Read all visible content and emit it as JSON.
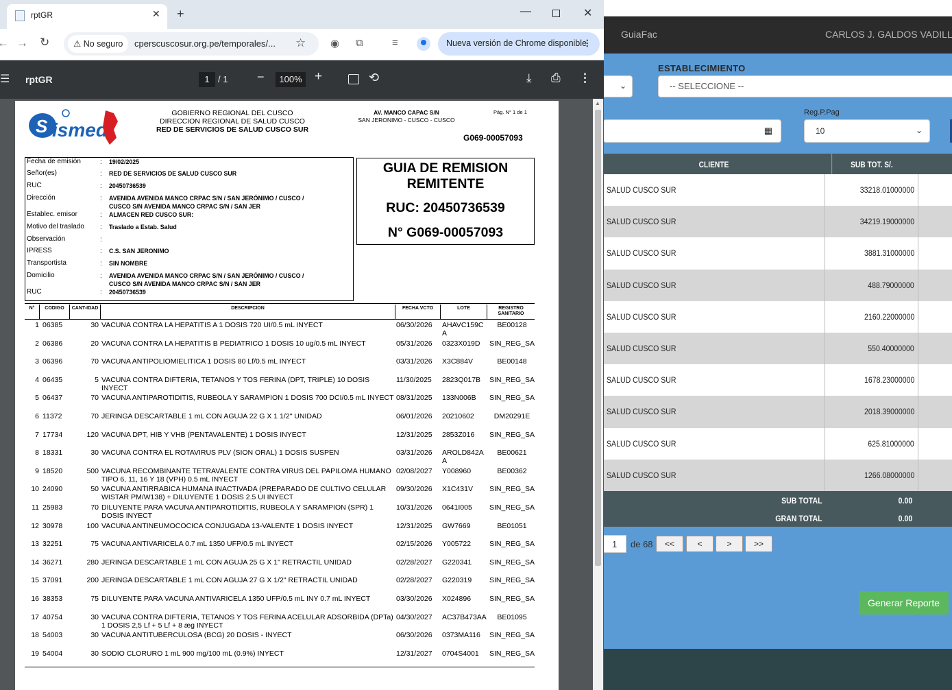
{
  "background_app": {
    "brand": "GuiaFac",
    "user": "CARLOS J. GALDOS VADILLO",
    "establecimiento_label": "ESTABLECIMIENTO",
    "establecimiento_value": "-- SELECCIONE --",
    "regpag_label": "Reg.P.Pag",
    "regpag_value": "10",
    "table": {
      "columns": [
        "CLIENTE",
        "SUB TOT. S/."
      ],
      "rows": [
        {
          "cliente": "SALUD CUSCO SUR",
          "subtot": "33218.01000000"
        },
        {
          "cliente": "SALUD CUSCO SUR",
          "subtot": "34219.19000000"
        },
        {
          "cliente": "SALUD CUSCO SUR",
          "subtot": "3881.31000000"
        },
        {
          "cliente": "SALUD CUSCO SUR",
          "subtot": "488.79000000"
        },
        {
          "cliente": "SALUD CUSCO SUR",
          "subtot": "2160.22000000"
        },
        {
          "cliente": "SALUD CUSCO SUR",
          "subtot": "550.40000000"
        },
        {
          "cliente": "SALUD CUSCO SUR",
          "subtot": "1678.23000000"
        },
        {
          "cliente": "SALUD CUSCO SUR",
          "subtot": "2018.39000000"
        },
        {
          "cliente": "SALUD CUSCO SUR",
          "subtot": "625.81000000"
        },
        {
          "cliente": "SALUD CUSCO SUR",
          "subtot": "1266.08000000"
        }
      ],
      "sub_total_label": "SUB TOTAL",
      "sub_total_value": "0.00",
      "gran_total_label": "GRAN TOTAL",
      "gran_total_value": "0.00"
    },
    "pager": {
      "current": "1",
      "of_label": "de 68",
      "first": "<<",
      "prev": "<",
      "next": ">",
      "last": ">>"
    },
    "generate_button": "Generar Reporte"
  },
  "browser": {
    "tab_title": "rptGR",
    "security_label": "No seguro",
    "url": "cperscuscosur.org.pe/temporales/...",
    "update_label": "Nueva versión de Chrome disponible"
  },
  "pdf_viewer": {
    "title": "rptGR",
    "page_current": "1",
    "page_total": "/ 1",
    "zoom": "100%"
  },
  "document": {
    "logo_text": "ismed",
    "org_line1": "GOBIERNO REGIONAL DEL CUSCO",
    "org_line2": "DIRECCION REGIONAL DE SALUD CUSCO",
    "org_line3": "RED DE SERVICIOS DE SALUD CUSCO SUR",
    "address_line1": "AV. MANCO CAPAC S/N",
    "address_line2": "SAN JERONIMO - CUSCO - CUSCO",
    "page_number": "Pág. N° 1 de 1",
    "doc_number_top": "G069-00057093",
    "info": [
      {
        "label": "Fecha de emisión",
        "value": "19/02/2025"
      },
      {
        "label": "Señor(es)",
        "value": "RED DE SERVICIOS DE SALUD CUSCO SUR"
      },
      {
        "label": "RUC",
        "value": "20450736539"
      },
      {
        "label": "Dirección",
        "value": "AVENIDA AVENIDA MANCO CRPAC S/N / SAN JERÓNIMO / CUSCO /",
        "value2": "CUSCO S/N AVENIDA MANCO CRPAC S/N / SAN JER"
      },
      {
        "label": "Establec. emisor",
        "value": "ALMACEN RED CUSCO SUR:"
      },
      {
        "label": "Motivo del traslado",
        "value": "Traslado a Estab. Salud"
      },
      {
        "label": "Observación",
        "value": ""
      },
      {
        "label": "IPRESS",
        "value": "C.S. SAN JERONIMO"
      },
      {
        "label": "Transportista",
        "value": "SIN NOMBRE"
      },
      {
        "label": "Domicilio",
        "value": "AVENIDA AVENIDA MANCO CRPAC S/N / SAN JERÓNIMO / CUSCO /",
        "value2": "CUSCO S/N AVENIDA MANCO CRPAC S/N / SAN JER"
      },
      {
        "label": "RUC",
        "value": "20450736539"
      }
    ],
    "guia_title1": "GUIA DE REMISION",
    "guia_title2": "REMITENTE",
    "guia_ruc": "RUC: 20450736539",
    "guia_num": "N° G069-00057093",
    "item_headers": {
      "n": "N°",
      "codigo": "CODIGO",
      "cantidad": "CANT-IDAD",
      "descripcion": "DESCRIPCION",
      "fecha": "FECHA VCTO",
      "lote": "LOTE",
      "registro": "REGISTRO SANITARIO"
    },
    "items": [
      {
        "n": "1",
        "cod": "06385",
        "qty": "30",
        "desc": "VACUNA CONTRA LA HEPATITIS A 1 DOSIS 720 UI/0.5 mL INYECT",
        "fv": "06/30/2026",
        "lote": "AHAVC159CA",
        "reg": "BE00128"
      },
      {
        "n": "2",
        "cod": "06386",
        "qty": "20",
        "desc": "VACUNA CONTRA LA HEPATITIS B PEDIATRICO 1 DOSIS 10 ug/0.5 mL INYECT",
        "fv": "05/31/2026",
        "lote": "0323X019D",
        "reg": "SIN_REG_SA"
      },
      {
        "n": "3",
        "cod": "06396",
        "qty": "70",
        "desc": "VACUNA ANTIPOLIOMIELITICA 1 DOSIS 80 Lf/0.5 mL INYECT",
        "fv": "03/31/2026",
        "lote": "X3C884V",
        "reg": "BE00148"
      },
      {
        "n": "4",
        "cod": "06435",
        "qty": "5",
        "desc": "VACUNA CONTRA DIFTERIA, TETANOS Y TOS FERINA (DPT, TRIPLE) 10 DOSIS INYECT",
        "fv": "11/30/2025",
        "lote": "2823Q017B",
        "reg": "SIN_REG_SA"
      },
      {
        "n": "5",
        "cod": "06437",
        "qty": "70",
        "desc": "VACUNA ANTIPAROTIDITIS, RUBEOLA Y SARAMPION 1 DOSIS 700 DCI/0.5 mL INYECT",
        "fv": "08/31/2025",
        "lote": "133N006B",
        "reg": "SIN_REG_SA"
      },
      {
        "n": "6",
        "cod": "11372",
        "qty": "70",
        "desc": "JERINGA DESCARTABLE 1 mL CON AGUJA 22 G X 1 1/2\"   UNIDAD",
        "fv": "06/01/2026",
        "lote": "20210602",
        "reg": "DM20291E"
      },
      {
        "n": "7",
        "cod": "17734",
        "qty": "120",
        "desc": "VACUNA DPT, HIB Y VHB (PENTAVALENTE) 1 DOSIS  INYECT",
        "fv": "12/31/2025",
        "lote": "2853Z016",
        "reg": "SIN_REG_SA"
      },
      {
        "n": "8",
        "cod": "18331",
        "qty": "30",
        "desc": "VACUNA CONTRA EL ROTAVIRUS  PLV (SION ORAL) 1 DOSIS  SUSPEN",
        "fv": "03/31/2026",
        "lote": "AROLD842AA",
        "reg": "BE00621"
      },
      {
        "n": "9",
        "cod": "18520",
        "qty": "500",
        "desc": "VACUNA RECOMBINANTE TETRAVALENTE CONTRA VIRUS DEL PAPILOMA HUMANO TIPO 6, 11, 16 Y 18 (VPH) 0.5 mL  INYECT",
        "fv": "02/08/2027",
        "lote": "Y008960",
        "reg": "BE00362"
      },
      {
        "n": "10",
        "cod": "24090",
        "qty": "50",
        "desc": "VACUNA ANTIRRABICA HUMANA INACTIVADA (PREPARADO DE CULTIVO CELULAR WISTAR PM/W138) + DILUYENTE 1 DOSIS 2.5 UI INYECT",
        "fv": "09/30/2026",
        "lote": "X1C431V",
        "reg": "SIN_REG_SA"
      },
      {
        "n": "11",
        "cod": "25983",
        "qty": "70",
        "desc": "DILUYENTE PARA VACUNA ANTIPAROTIDITIS, RUBEOLA Y SARAMPION (SPR) 1 DOSIS  INYECT",
        "fv": "10/31/2026",
        "lote": "0641I005",
        "reg": "SIN_REG_SA"
      },
      {
        "n": "12",
        "cod": "30978",
        "qty": "100",
        "desc": "VACUNA ANTINEUMOCOCICA CONJUGADA 13-VALENTE 1 DOSIS  INYECT",
        "fv": "12/31/2025",
        "lote": "GW7669",
        "reg": "BE01051"
      },
      {
        "n": "13",
        "cod": "32251",
        "qty": "75",
        "desc": "VACUNA ANTIVARICELA 0.7 mL 1350 UFP/0.5 mL INYECT",
        "fv": "02/15/2026",
        "lote": "Y005722",
        "reg": "SIN_REG_SA"
      },
      {
        "n": "14",
        "cod": "36271",
        "qty": "280",
        "desc": "JERINGA DESCARTABLE 1 mL CON AGUJA 25 G X 1\" RETRACTIL   UNIDAD",
        "fv": "02/28/2027",
        "lote": "G220341",
        "reg": "SIN_REG_SA"
      },
      {
        "n": "15",
        "cod": "37091",
        "qty": "200",
        "desc": "JERINGA DESCARTABLE 1 mL CON AGUJA 27 G X 1/2\" RETRACTIL   UNIDAD",
        "fv": "02/28/2027",
        "lote": "G220319",
        "reg": "SIN_REG_SA"
      },
      {
        "n": "16",
        "cod": "38353",
        "qty": "75",
        "desc": "DILUYENTE PARA VACUNA ANTIVARICELA 1350 UFP/0.5 mL INY 0.7 mL   INYECT",
        "fv": "03/30/2026",
        "lote": "X024896",
        "reg": "SIN_REG_SA"
      },
      {
        "n": "17",
        "cod": "40754",
        "qty": "30",
        "desc": "VACUNA CONTRA DIFTERIA, TETANOS Y TOS FERINA ACELULAR ADSORBIDA (DPTa) 1 DOSIS 2,5 Lf + 5 Lf + 8 æg INYECT",
        "fv": "04/30/2027",
        "lote": "AC37B473AA",
        "reg": "BE01095"
      },
      {
        "n": "18",
        "cod": "54003",
        "qty": "30",
        "desc": "VACUNA ANTITUBERCULOSA (BCG) 20 DOSIS - INYECT",
        "fv": "06/30/2026",
        "lote": "0373MA116",
        "reg": "SIN_REG_SA"
      },
      {
        "n": "19",
        "cod": "54004",
        "qty": "30",
        "desc": "SODIO CLORURO 1 mL 900 mg/100 mL (0.9%) INYECT",
        "fv": "12/31/2027",
        "lote": "0704S4001",
        "reg": "SIN_REG_SA"
      }
    ]
  }
}
